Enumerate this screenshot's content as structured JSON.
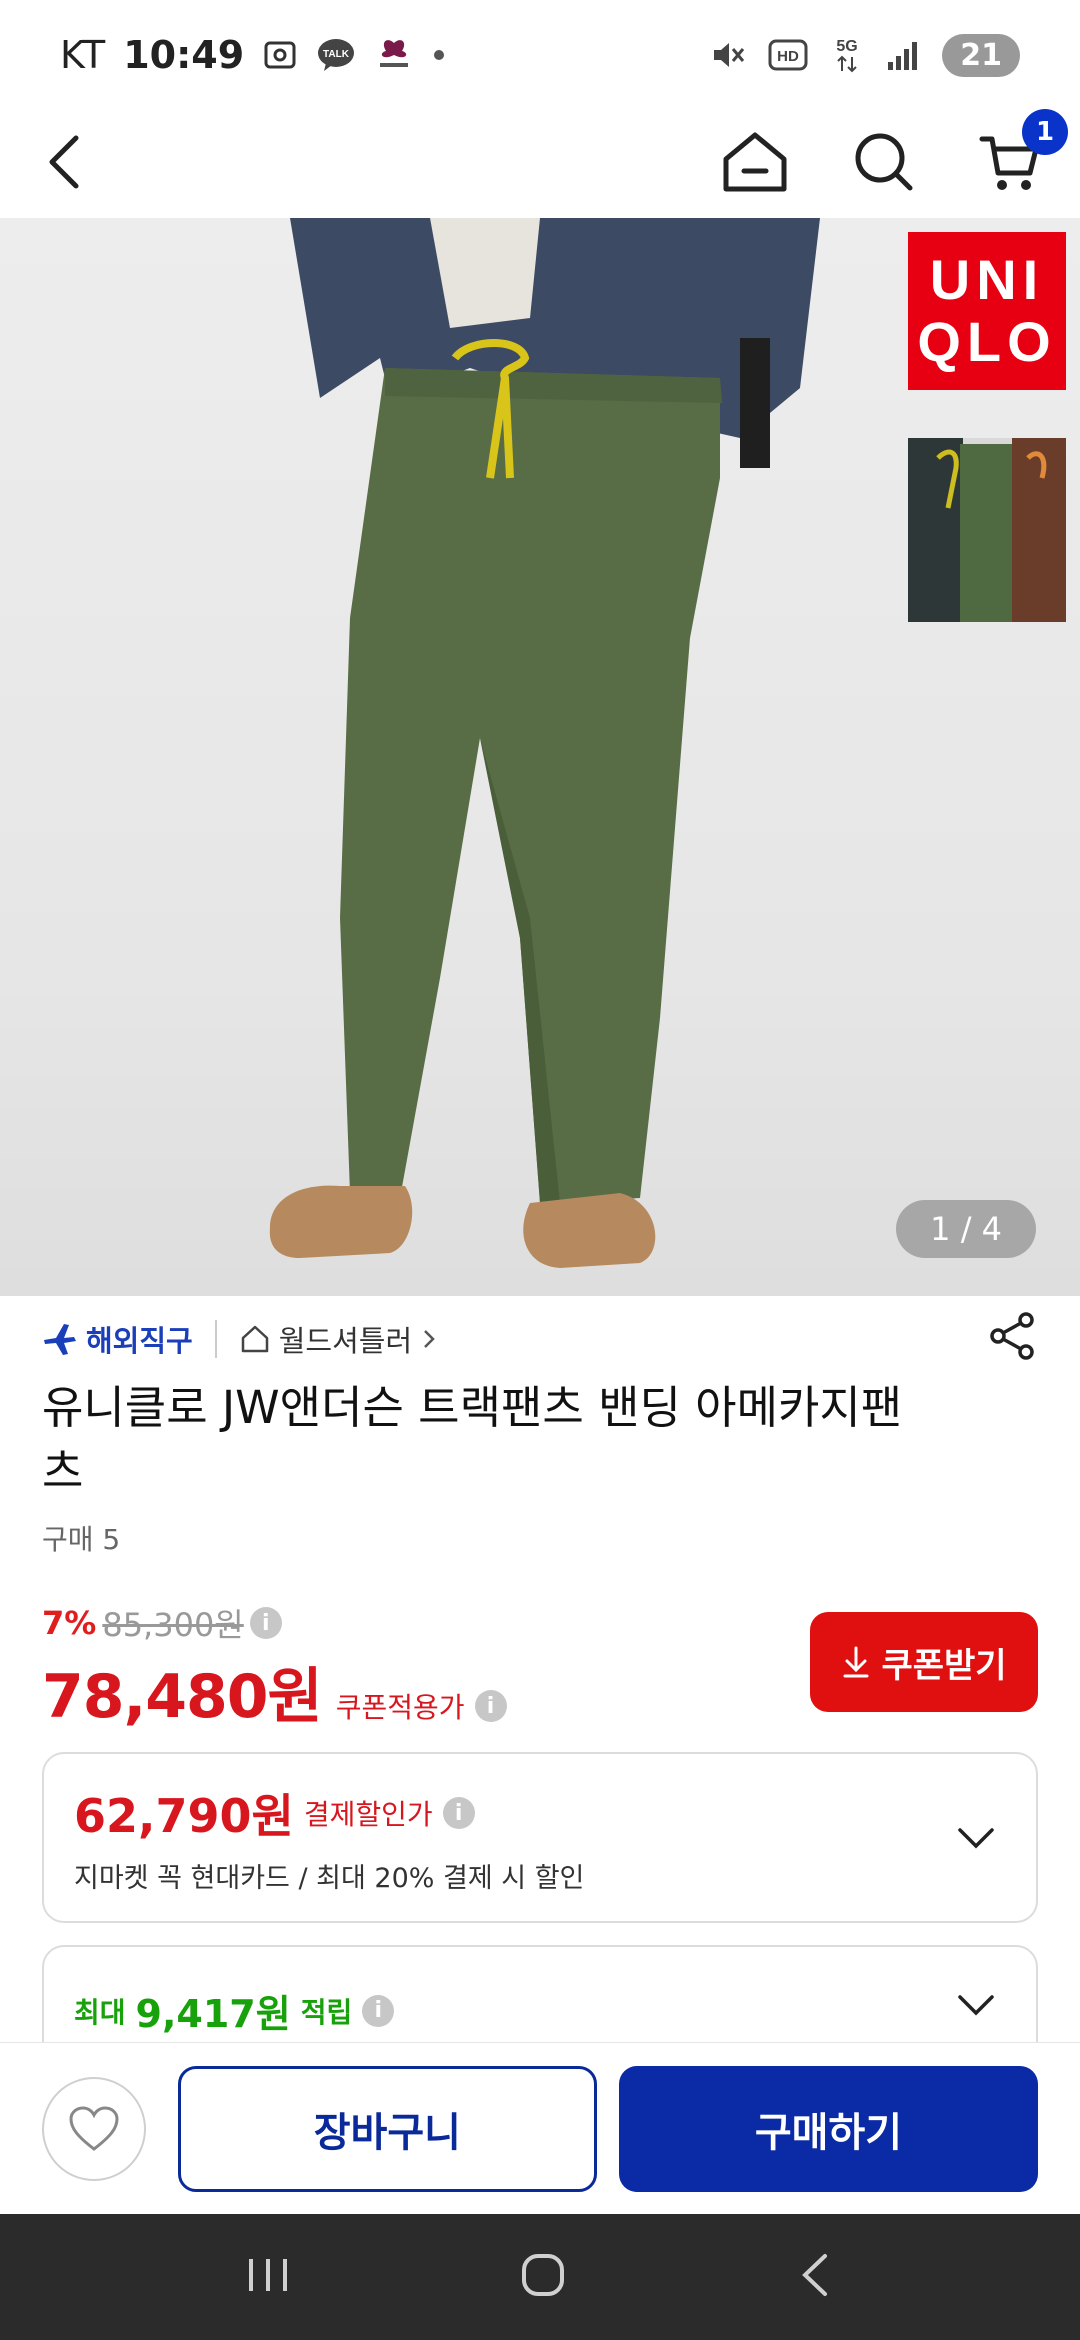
{
  "status_bar": {
    "carrier": "KT",
    "time": "10:49",
    "talk_label": "TALK",
    "network": "5G",
    "hd": "HD",
    "battery": "21"
  },
  "product": {
    "image_counter": "1 / 4",
    "brand_logo_line1": "UNI",
    "brand_logo_line2": "QLO",
    "overseas_label": "해외직구",
    "seller_name": "월드셔틀러",
    "title": "유니클로 JW앤더슨 트랙팬츠 밴딩 아메카지팬츠",
    "purchase_count": "구매 5"
  },
  "price": {
    "discount_rate": "7%",
    "original": "85,300원",
    "sale": "78,480원",
    "sale_note": "쿠폰적용가",
    "coupon_button": "쿠폰받기"
  },
  "card_discount": {
    "price": "62,790원",
    "label": "결제할인가",
    "desc": "지마켓 꼭 현대카드 / 최대 20% 결제 시 할인"
  },
  "card_reward": {
    "prefix": "최대",
    "amount": "9,417원",
    "label": "적립"
  },
  "nav": {
    "cart_count": "1"
  },
  "actions": {
    "cart": "장바구니",
    "buy": "구매하기"
  },
  "colors": {
    "accent_blue": "#0a2aa6",
    "price_red": "#d7161e",
    "reward_green": "#17a10a"
  }
}
